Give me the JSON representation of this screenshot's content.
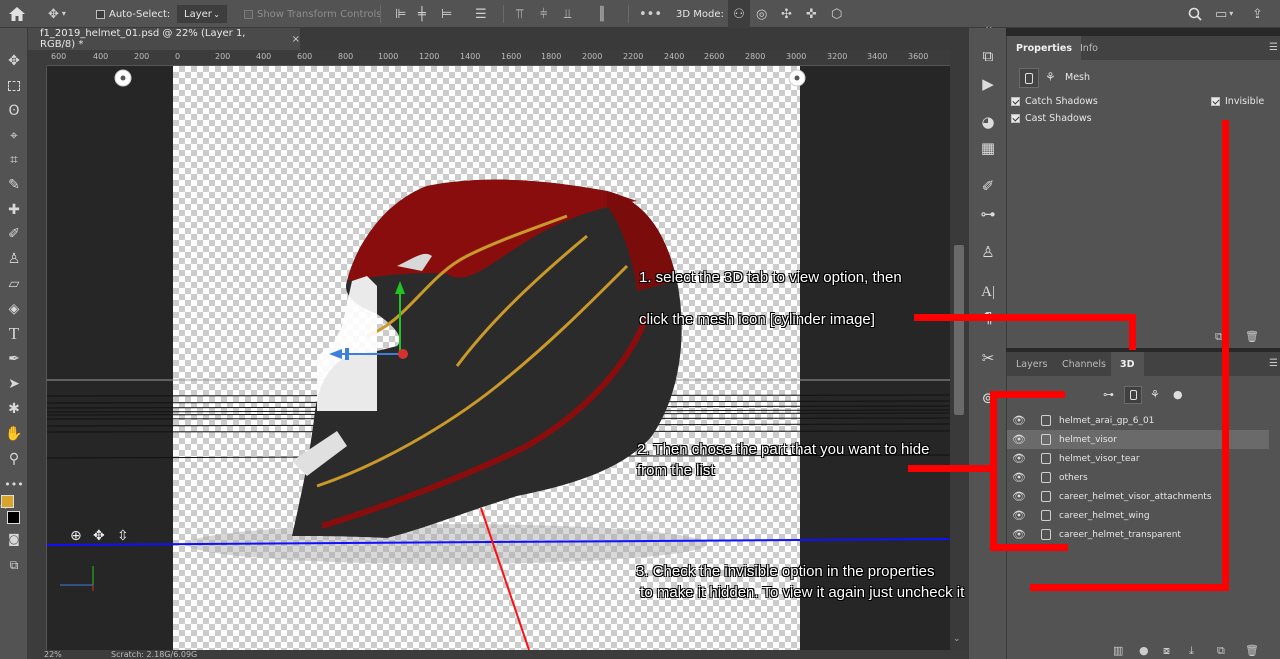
{
  "options_bar": {
    "auto_select_label": "Auto-Select:",
    "layer_dropdown": "Layer",
    "transform_controls_label": "Show Transform Controls",
    "mode_3d_label": "3D Mode:"
  },
  "document": {
    "tab_title": "f1_2019_helmet_01.psd @ 22% (Layer 1, RGB/8) *",
    "close_glyph": "×"
  },
  "ruler": {
    "ticks": [
      "600",
      "400",
      "200",
      "0",
      "200",
      "400",
      "600",
      "800",
      "1000",
      "1200",
      "1400",
      "1600",
      "1800",
      "2000",
      "2200",
      "2400",
      "2600",
      "2800",
      "3000",
      "3200",
      "3400",
      "3600"
    ]
  },
  "status_bar": {
    "zoom": "22%",
    "scratch": "Scratch: 2.18G/6.09G"
  },
  "properties_panel": {
    "tabs": [
      "Properties",
      "Info"
    ],
    "mesh_label": "Mesh",
    "catch_shadows": "Catch Shadows",
    "cast_shadows": "Cast Shadows",
    "invisible": "Invisible"
  },
  "layers_panel": {
    "tabs": [
      "Layers",
      "Channels",
      "3D"
    ],
    "items": [
      {
        "name": "helmet_arai_gp_6_01",
        "selected": false
      },
      {
        "name": "helmet_visor",
        "selected": true
      },
      {
        "name": "helmet_visor_tear",
        "selected": false
      },
      {
        "name": "others",
        "selected": false
      },
      {
        "name": "career_helmet_visor_attachments",
        "selected": false
      },
      {
        "name": "career_helmet_wing",
        "selected": false
      },
      {
        "name": "career_helmet_transparent",
        "selected": false
      }
    ]
  },
  "annotations": {
    "step1_line1": "1. select the 3D tab to view option, then",
    "step1_line2": "click the mesh icon [cylinder image]",
    "step2_line1": "2. Then chose the part that you want to hide",
    "step2_line2": "from the list",
    "step3_line1": "3. Check the invisible option in the properties",
    "step3_line2": " to make it hidden. To view it again just uncheck it"
  },
  "colors": {
    "annotation_red": "#ff0000",
    "panel_bg": "#535353",
    "canvas_bg": "#262626",
    "swatch_foreground": "#d9a42a",
    "swatch_background": "#000000"
  }
}
